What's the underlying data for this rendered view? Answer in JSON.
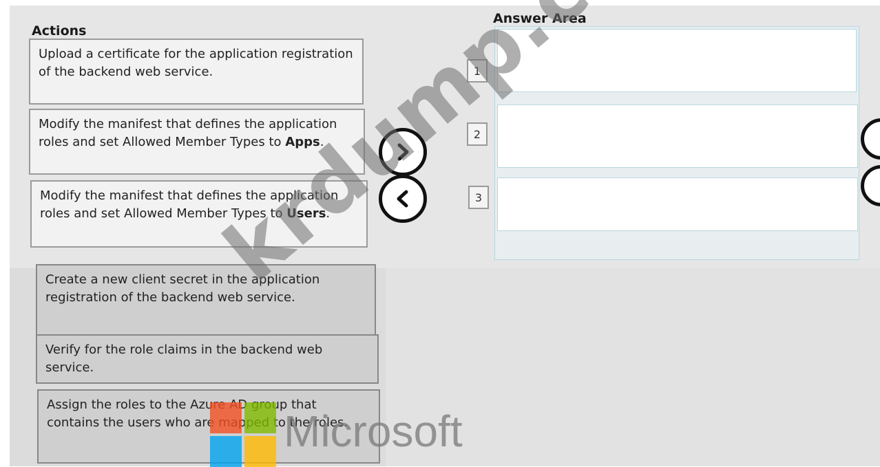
{
  "actions": {
    "title": "Actions",
    "items": [
      {
        "text": "Upload a certificate for the application registration of the backend web service.",
        "bold": ""
      },
      {
        "text": "Modify the manifest that defines the application roles and set Allowed Member Types to ",
        "bold": "Apps",
        "tail": "."
      },
      {
        "text": "Modify the manifest that defines the application roles and set Allowed Member Types to ",
        "bold": "Users",
        "tail": "."
      },
      {
        "text": "Create a new client secret in the application registration of the backend web service.",
        "bold": ""
      },
      {
        "text": "Verify for the role claims in the backend web service.",
        "bold": ""
      },
      {
        "text": "Assign the roles to the Azure AD group that contains the users who are mapped to the roles.",
        "bold": ""
      }
    ]
  },
  "answer_area": {
    "title": "Answer Area",
    "slots": [
      "1",
      "2",
      "3"
    ]
  },
  "watermark": {
    "text": "krdump.com",
    "brand": "Microsoft"
  },
  "colors": {
    "ms_red": "#f25022",
    "ms_green": "#7fba00",
    "ms_blue": "#00a4ef",
    "ms_yellow": "#ffb900"
  },
  "icons": {
    "move_right": "chevron-right-icon",
    "move_left": "chevron-left-icon"
  }
}
